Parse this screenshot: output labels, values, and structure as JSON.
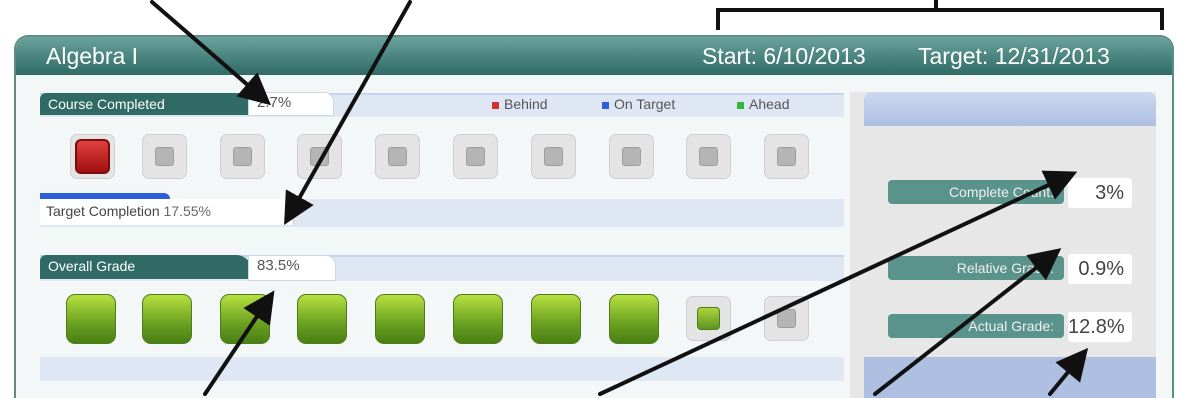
{
  "header": {
    "course": "Algebra I",
    "start": "Start: 6/10/2013",
    "target": "Target: 12/31/2013"
  },
  "course_completed": {
    "label": "Course Completed",
    "value": "2.7%",
    "legend": [
      {
        "label": "Behind",
        "color": "#d13232"
      },
      {
        "label": "On Target",
        "color": "#2f5de0"
      },
      {
        "label": "Ahead",
        "color": "#36b33a"
      }
    ],
    "target_label": "Target Completion",
    "target_value": "17.55%"
  },
  "overall_grade": {
    "label": "Overall Grade",
    "value": "83.5%"
  },
  "stats": {
    "complete_count": {
      "label": "Complete Count:",
      "value": "3%"
    },
    "relative_grade": {
      "label": "Relative Grade:",
      "value": "0.9%"
    },
    "actual_grade": {
      "label": "Actual Grade:",
      "value": "12.8%"
    }
  }
}
